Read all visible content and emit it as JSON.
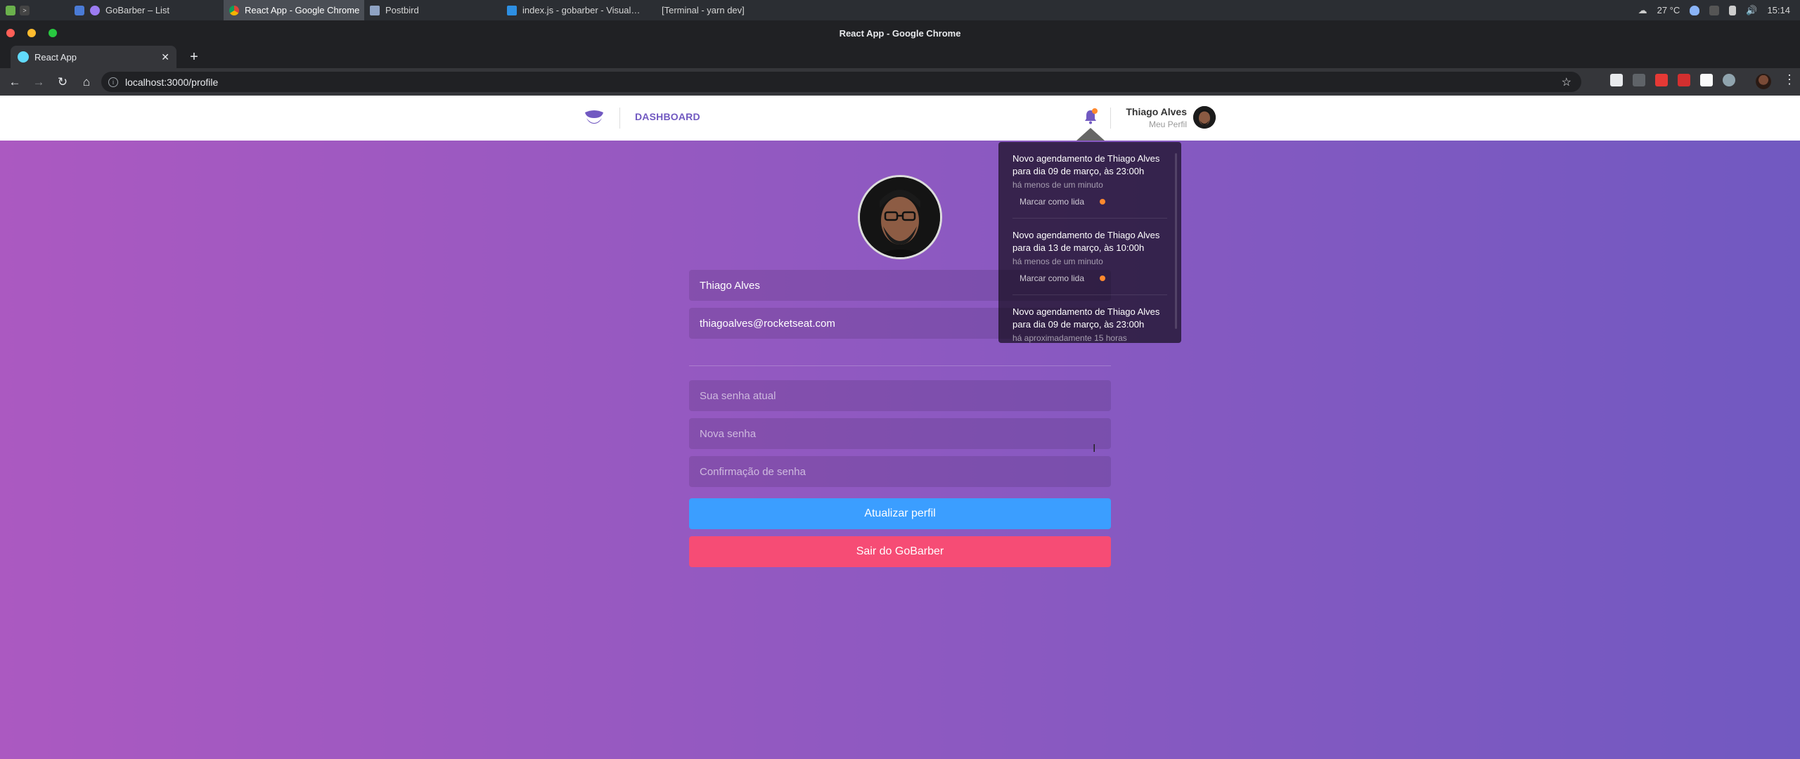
{
  "taskbar": {
    "tasks": [
      {
        "label": "GoBarber – List",
        "active": false
      },
      {
        "label": "React App - Google Chrome",
        "active": true
      },
      {
        "label": "Postbird",
        "active": false
      },
      {
        "label": "index.js - gobarber - Visual…",
        "active": false
      },
      {
        "label": "[Terminal - yarn dev]",
        "active": false
      }
    ],
    "weather": "27 °C",
    "clock": "15:14"
  },
  "window": {
    "title": "React App - Google Chrome"
  },
  "browser": {
    "tab_title": "React App",
    "tab_close": "✕",
    "new_tab": "+",
    "url": "localhost:3000/profile",
    "back": "←",
    "forward": "→",
    "reload": "↻",
    "home": "⌂",
    "star": "☆",
    "menu": "⋮"
  },
  "header": {
    "nav_dashboard": "DASHBOARD",
    "user_name": "Thiago Alves",
    "profile_link": "Meu Perfil"
  },
  "notifications": [
    {
      "text": "Novo agendamento de Thiago Alves para dia 09 de março, às 23:00h",
      "time": "há menos de um minuto",
      "mark_read": "Marcar como lida",
      "unread": true
    },
    {
      "text": "Novo agendamento de Thiago Alves para dia 13 de março, às 10:00h",
      "time": "há menos de um minuto",
      "mark_read": "Marcar como lida",
      "unread": true
    },
    {
      "text": "Novo agendamento de Thiago Alves para dia 09 de março, às 23:00h",
      "time": "há aproximadamente 15 horas",
      "mark_read": "",
      "unread": false
    }
  ],
  "profile": {
    "name_value": "Thiago Alves",
    "email_value": "thiagoalves@rocketseat.com",
    "old_password_placeholder": "Sua senha atual",
    "new_password_placeholder": "Nova senha",
    "confirm_password_placeholder": "Confirmação de senha",
    "update_button": "Atualizar perfil",
    "logout_button": "Sair do GoBarber"
  },
  "colors": {
    "brand_purple": "#7159c1",
    "gradient_end": "#ab59c1",
    "update_blue": "#3b9eff",
    "logout_pink": "#f64c75",
    "notification_dot": "#ff892e"
  }
}
